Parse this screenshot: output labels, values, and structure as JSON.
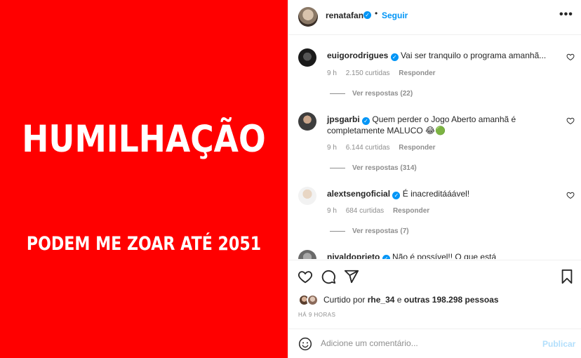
{
  "post_image": {
    "headline": "HUMILHAÇÃO",
    "subline": "PODEM ME ZOAR ATÉ 2051",
    "background_color": "#ff0000"
  },
  "header": {
    "username": "renatafan",
    "separator": "•",
    "follow_label": "Seguir",
    "more_icon": "more-horizontal-icon"
  },
  "comments": [
    {
      "username": "euigorodrigues",
      "text": "Vai ser tranquilo o programa amanhã...",
      "time": "9 h",
      "likes": "2.150 curtidas",
      "reply_label": "Responder",
      "view_replies": "Ver respostas (22)"
    },
    {
      "username": "jpsgarbi",
      "text": "Quem perder o Jogo Aberto amanhã é completamente MALUCO 😂🟢",
      "time": "9 h",
      "likes": "6.144 curtidas",
      "reply_label": "Responder",
      "view_replies": "Ver respostas (314)"
    },
    {
      "username": "alextsengoficial",
      "text": "É inacreditááável!",
      "time": "9 h",
      "likes": "684 curtidas",
      "reply_label": "Responder",
      "view_replies": "Ver respostas (7)"
    },
    {
      "username": "nivaldoprieto",
      "text": "Não é possível!! O que está acontecendo?!!!"
    }
  ],
  "actions": {
    "like_icon": "heart-icon",
    "comment_icon": "comment-icon",
    "share_icon": "send-icon",
    "save_icon": "bookmark-icon"
  },
  "likes_summary": {
    "prefix": "Curtido por",
    "user": "rhe_34",
    "connector": "e",
    "others": "outras 198.298 pessoas"
  },
  "time_ago": "HÁ 9 HORAS",
  "add_comment": {
    "placeholder": "Adicione um comentário...",
    "post_label": "Publicar",
    "emoji_icon": "smiley-icon"
  },
  "colors": {
    "accent": "#0095f6",
    "muted": "#8e8e8e",
    "post_disabled": "#b2dffc"
  }
}
